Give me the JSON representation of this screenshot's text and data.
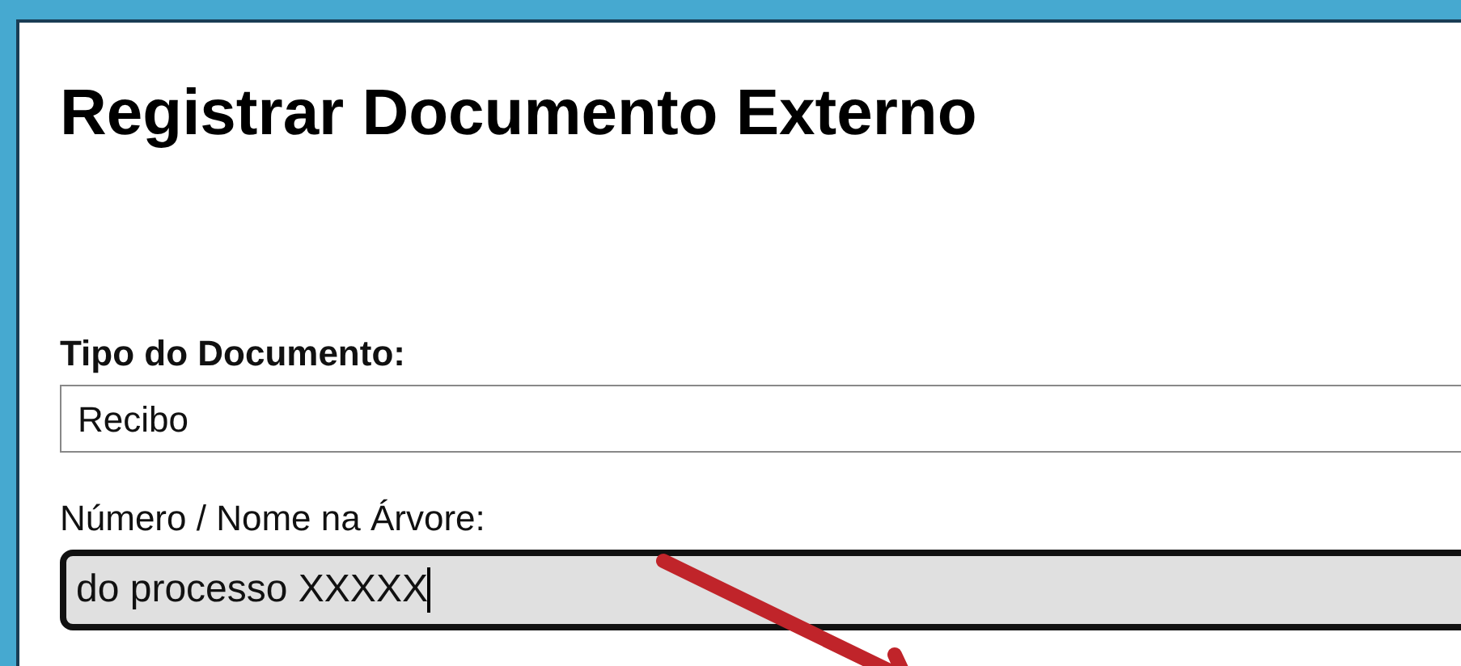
{
  "title": "Registrar Documento Externo",
  "fields": [
    {
      "kind": "select",
      "label": "Tipo do Documento:",
      "bold": true,
      "value": "Recibo"
    },
    {
      "kind": "text",
      "label": "Número / Nome na Árvore:",
      "bold": false,
      "value": "do processo XXXXX",
      "focused": true
    }
  ]
}
